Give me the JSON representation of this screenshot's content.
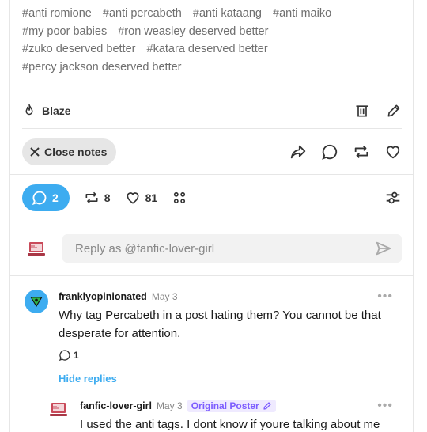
{
  "tags": {
    "rows": [
      [
        "#anti romione",
        "#anti percabeth",
        "#anti kataang",
        "#anti maiko"
      ],
      [
        "#my poor babies",
        "#ron weasley deserved better"
      ],
      [
        "#zuko deserved better",
        "#katara deserved better"
      ],
      [
        "#percy jackson deserved better"
      ]
    ]
  },
  "blaze": {
    "label": "Blaze"
  },
  "actions": {
    "close_notes_label": "Close notes"
  },
  "notes": {
    "replies_count": "2",
    "reblogs_count": "8",
    "likes_count": "81"
  },
  "reply": {
    "placeholder": "Reply as @fanfic-lover-girl"
  },
  "comments": [
    {
      "username": "franklyopinionated",
      "date": "May 3",
      "menu": "•••",
      "text": "Why tag Percabeth in a post hating them? You cannot be that desperate for attention.",
      "likes": "1",
      "hide_replies": "Hide replies"
    },
    {
      "username": "fanfic-lover-girl",
      "date": "May 3",
      "badge": "Original Poster",
      "menu": "•••",
      "text": "I used the anti tags. I dont know if youre talking about me"
    }
  ],
  "colors": {
    "accent": "#3dacf0",
    "op_badge": "#7c5cff",
    "divider": "#e6e6e6"
  }
}
